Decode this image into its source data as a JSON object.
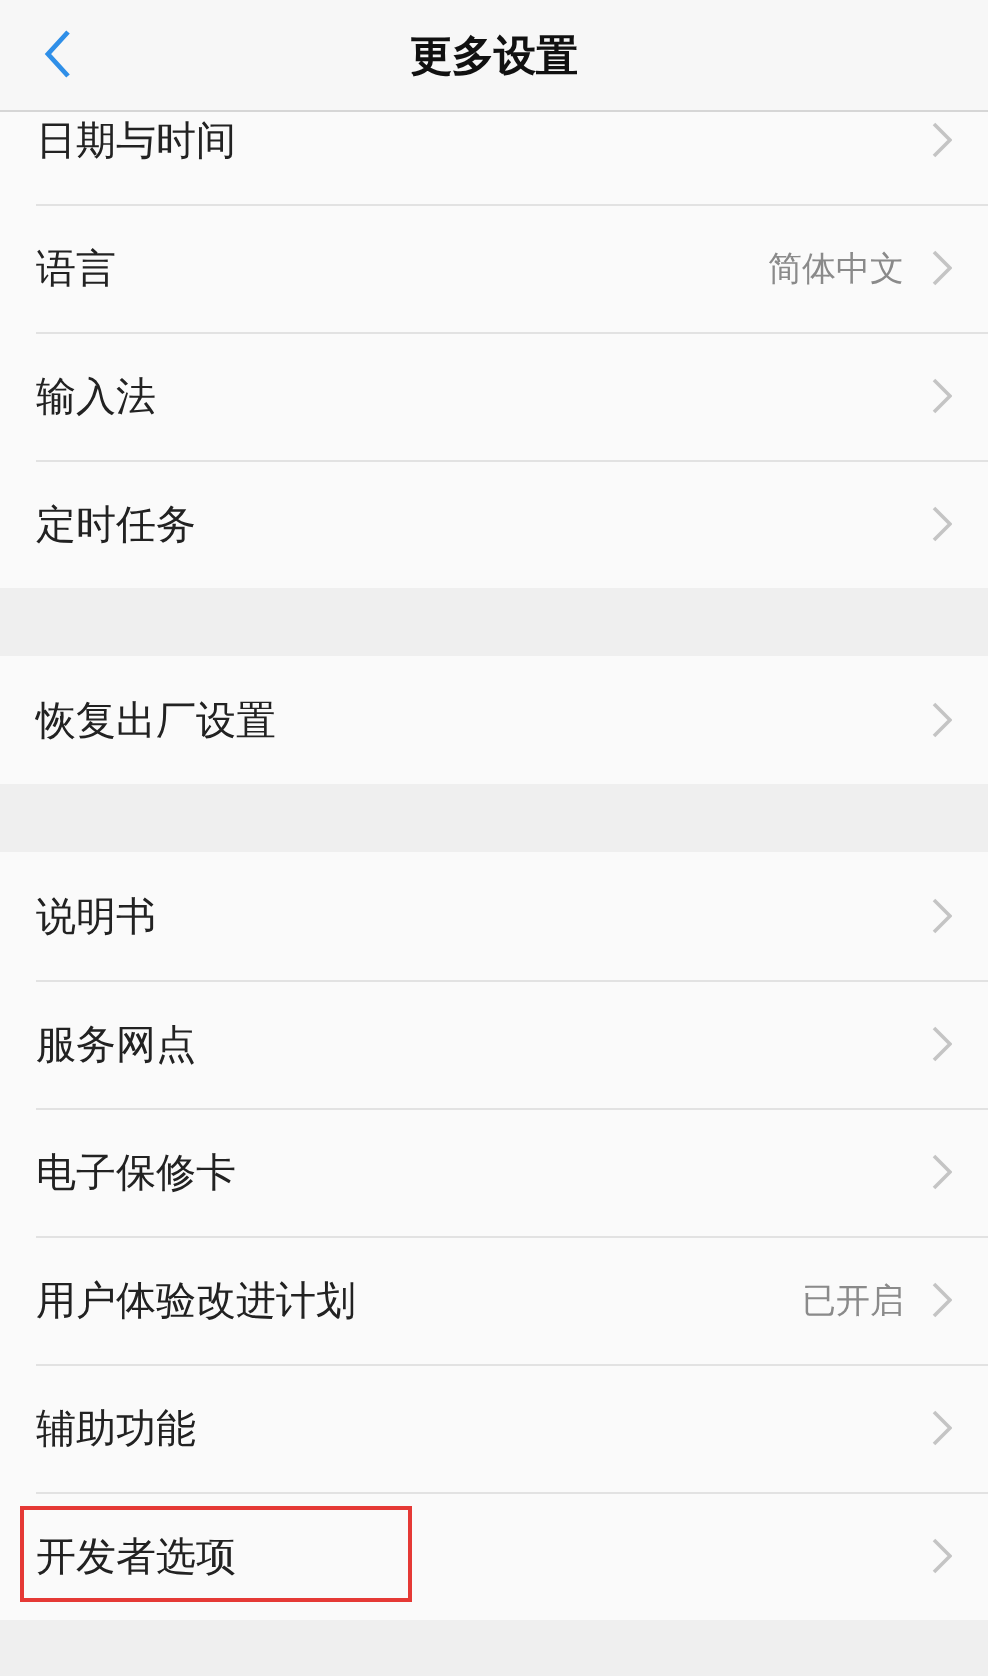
{
  "header": {
    "title": "更多设置"
  },
  "groups": [
    {
      "items": [
        {
          "label": "日期与时间",
          "highlighted": false
        },
        {
          "label": "语言",
          "value": "简体中文",
          "highlighted": false
        },
        {
          "label": "输入法",
          "highlighted": false
        },
        {
          "label": "定时任务",
          "highlighted": false
        }
      ]
    },
    {
      "items": [
        {
          "label": "恢复出厂设置",
          "highlighted": false
        }
      ]
    },
    {
      "items": [
        {
          "label": "说明书",
          "highlighted": false
        },
        {
          "label": "服务网点",
          "highlighted": false
        },
        {
          "label": "电子保修卡",
          "highlighted": false
        },
        {
          "label": "用户体验改进计划",
          "value": "已开启",
          "highlighted": false
        },
        {
          "label": "辅助功能",
          "highlighted": false
        },
        {
          "label": "开发者选项",
          "highlighted": true
        }
      ]
    }
  ]
}
